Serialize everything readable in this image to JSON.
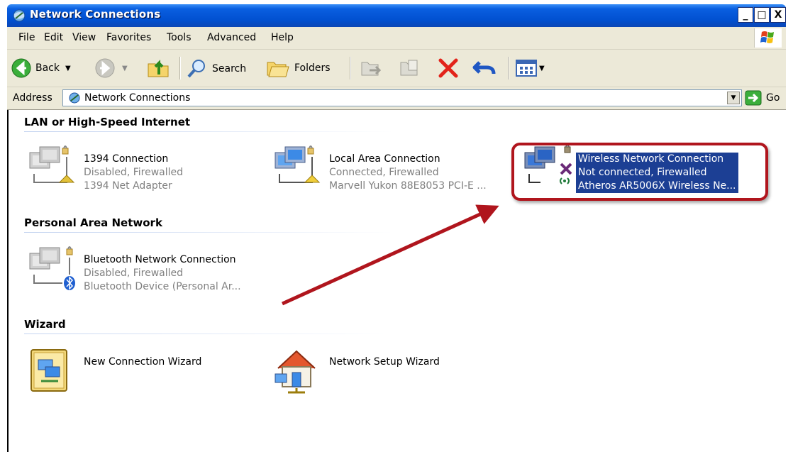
{
  "window": {
    "title": "Network Connections",
    "controls": [
      "_",
      "□",
      "X"
    ]
  },
  "menu": [
    {
      "label": "File",
      "accel": "F"
    },
    {
      "label": "Edit",
      "accel": "E"
    },
    {
      "label": "View",
      "accel": "V"
    },
    {
      "label": "Favorites",
      "accel": "a"
    },
    {
      "label": "Tools",
      "accel": "T"
    },
    {
      "label": "Advanced",
      "accel": "n"
    },
    {
      "label": "Help",
      "accel": "H"
    }
  ],
  "toolbar": {
    "back_label": "Back",
    "search_label": "Search",
    "folders_label": "Folders"
  },
  "address": {
    "label": "Address",
    "value": "Network Connections",
    "go_label": "Go"
  },
  "groups": {
    "lan": "LAN or High-Speed Internet",
    "pan": "Personal Area Network",
    "wizard": "Wizard"
  },
  "items": {
    "conn1394": {
      "name": "1394 Connection",
      "status": "Disabled, Firewalled",
      "device": "1394 Net Adapter"
    },
    "lan": {
      "name": "Local Area Connection",
      "status": "Connected, Firewalled",
      "device": "Marvell Yukon 88E8053 PCI-E ..."
    },
    "wireless": {
      "name": "Wireless Network Connection",
      "status": "Not connected, Firewalled",
      "device": "Atheros AR5006X Wireless Ne..."
    },
    "bluetooth": {
      "name": "Bluetooth Network Connection",
      "status": "Disabled, Firewalled",
      "device": "Bluetooth Device (Personal Ar..."
    },
    "new_wizard": {
      "name": "New Connection Wizard"
    },
    "setup_wizard": {
      "name": "Network Setup Wizard"
    }
  },
  "colors": {
    "selection": "#1c3f94",
    "annotation": "#b0151d"
  }
}
